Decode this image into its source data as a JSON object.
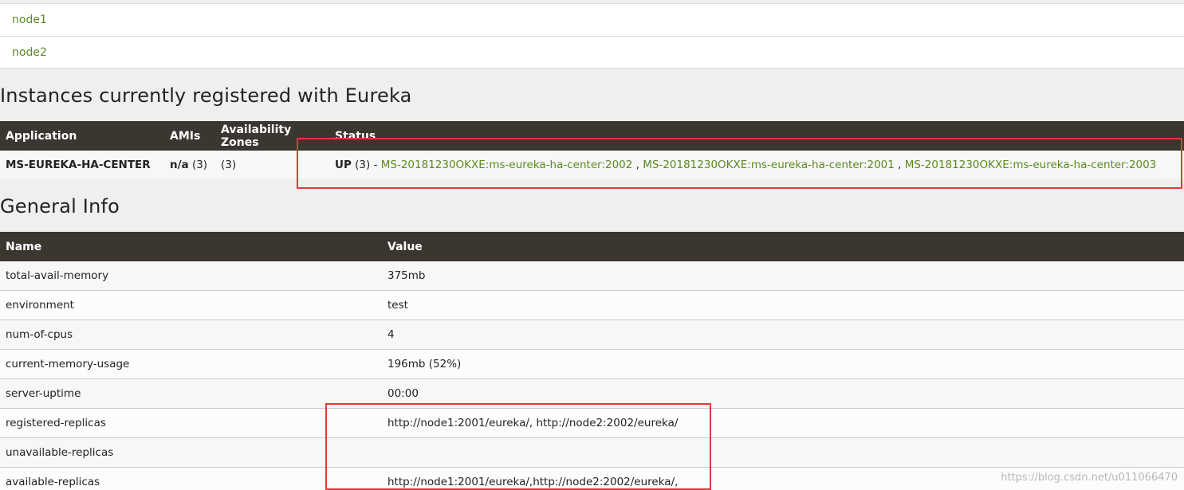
{
  "replicas": [
    "node1",
    "node2"
  ],
  "instances_section": {
    "title": "Instances currently registered with Eureka",
    "headers": {
      "application": "Application",
      "amis": "AMIs",
      "zones": "Availability Zones",
      "status": "Status"
    },
    "row": {
      "application": "MS-EUREKA-HA-CENTER",
      "amis_label": "n/a",
      "amis_count": "(3)",
      "zones": "(3)",
      "status_label": "UP",
      "status_count": "(3) -",
      "instances": [
        "MS-20181230OKXE:ms-eureka-ha-center:2002",
        "MS-20181230OKXE:ms-eureka-ha-center:2001",
        "MS-20181230OKXE:ms-eureka-ha-center:2003"
      ],
      "separator": " , "
    }
  },
  "general_info": {
    "title": "General Info",
    "headers": {
      "name": "Name",
      "value": "Value"
    },
    "rows": [
      {
        "name": "total-avail-memory",
        "value": "375mb"
      },
      {
        "name": "environment",
        "value": "test"
      },
      {
        "name": "num-of-cpus",
        "value": "4"
      },
      {
        "name": "current-memory-usage",
        "value": "196mb (52%)"
      },
      {
        "name": "server-uptime",
        "value": "00:00"
      },
      {
        "name": "registered-replicas",
        "value": "http://node1:2001/eureka/, http://node2:2002/eureka/"
      },
      {
        "name": "unavailable-replicas",
        "value": ""
      },
      {
        "name": "available-replicas",
        "value": "http://node1:2001/eureka/,http://node2:2002/eureka/,"
      }
    ]
  },
  "watermark": "https://blog.csdn.net/u011066470",
  "colors": {
    "header_bg": "#3b3630",
    "link": "#5a8a1e",
    "highlight": "#e0393a"
  }
}
